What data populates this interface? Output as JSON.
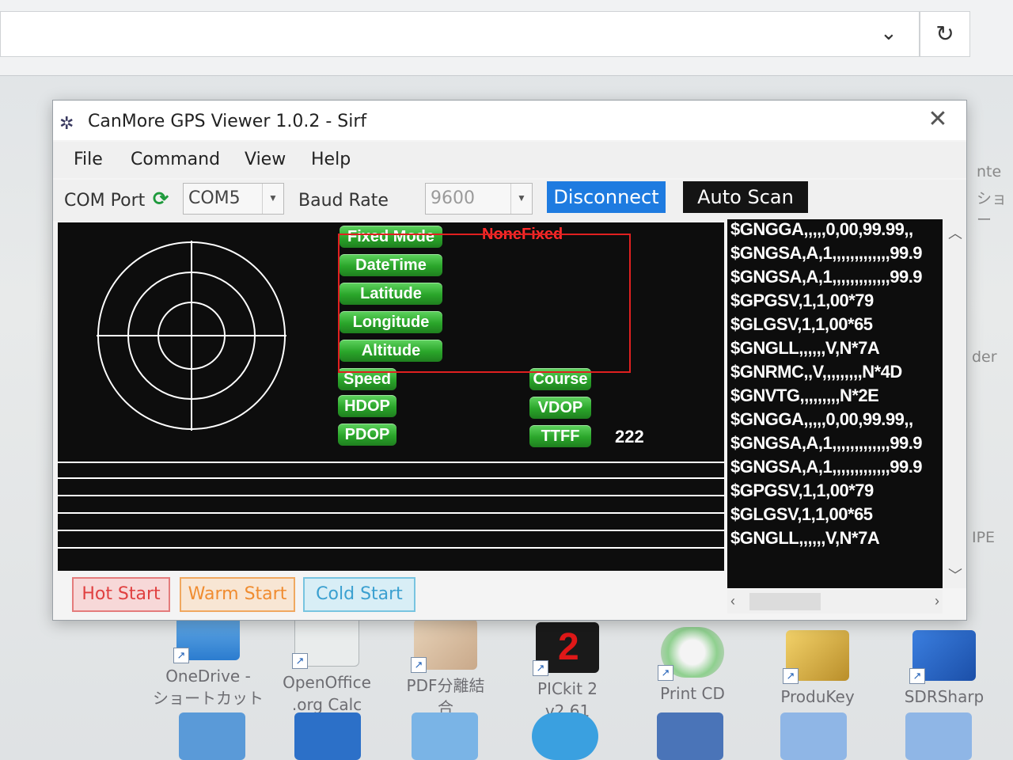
{
  "window": {
    "title": "CanMore GPS Viewer 1.0.2 - Sirf",
    "close_glyph": "✕"
  },
  "menu": [
    "File",
    "Command",
    "View",
    "Help"
  ],
  "toolbar": {
    "com_port_label": "COM Port",
    "com_port_value": "COM5",
    "baud_rate_label": "Baud Rate",
    "baud_rate_value": "9600",
    "disconnect_label": "Disconnect",
    "auto_scan_label": "Auto Scan"
  },
  "info_fields": {
    "fixed_mode": "Fixed Mode",
    "fixed_mode_value": "NoneFixed",
    "datetime": "DateTime",
    "latitude": "Latitude",
    "longitude": "Longitude",
    "altitude": "Altitude",
    "speed": "Speed",
    "course": "Course",
    "hdop": "HDOP",
    "vdop": "VDOP",
    "pdop": "PDOP",
    "ttff": "TTFF",
    "ttff_value": "222"
  },
  "nmea_lines": [
    "$GNGGA,,,,,0,00,99.99,,",
    "$GNGSA,A,1,,,,,,,,,,,,,99.9",
    "$GNGSA,A,1,,,,,,,,,,,,,99.9",
    "$GPGSV,1,1,00*79",
    "$GLGSV,1,1,00*65",
    "$GNGLL,,,,,,V,N*7A",
    "$GNRMC,,V,,,,,,,,,N*4D",
    "$GNVTG,,,,,,,,,N*2E",
    "$GNGGA,,,,,0,00,99.99,,",
    "$GNGSA,A,1,,,,,,,,,,,,,99.9",
    "$GNGSA,A,1,,,,,,,,,,,,,99.9",
    "$GPGSV,1,1,00*79",
    "$GLGSV,1,1,00*65",
    "$GNGLL,,,,,,V,N*7A"
  ],
  "start_buttons": {
    "hot": "Hot Start",
    "warm": "Warm Start",
    "cold": "Cold Start"
  },
  "desktop_icons": [
    {
      "label1": "OneDrive -",
      "label2": "ショートカット"
    },
    {
      "label1": "OpenOffice",
      "label2": ".org Calc"
    },
    {
      "label1": "PDF分離結",
      "label2": "合"
    },
    {
      "label1": "PICkit 2",
      "label2": "v2.61"
    },
    {
      "label1": "Print CD",
      "label2": ""
    },
    {
      "label1": "ProduKey",
      "label2": ""
    },
    {
      "label1": "SDRSharp",
      "label2": ""
    }
  ],
  "desktop_partial_labels": [
    "nte",
    "ショー",
    "der",
    "IPE"
  ],
  "browser": {
    "chevron_glyph": "⌄",
    "reload_glyph": "↻"
  }
}
